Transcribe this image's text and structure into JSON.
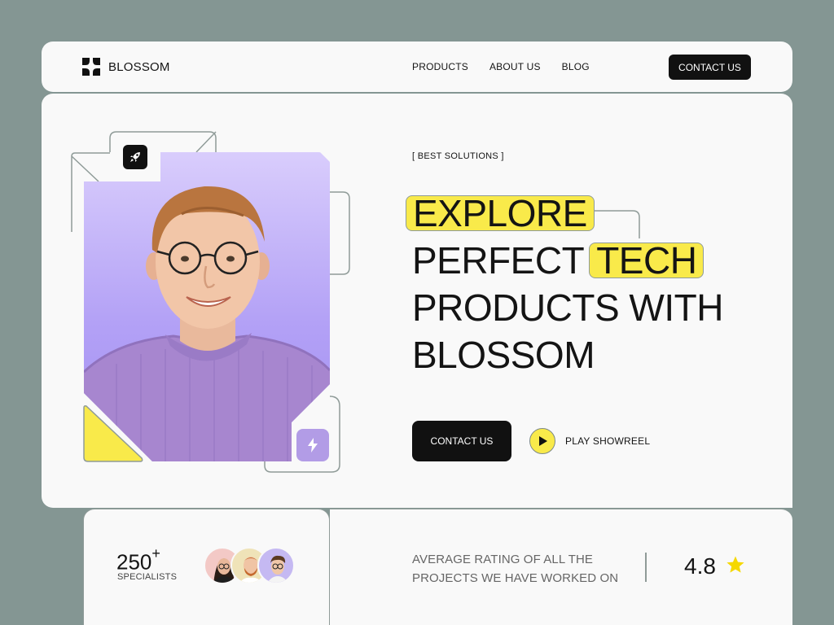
{
  "brand": {
    "name": "BLOSSOM"
  },
  "nav": {
    "items": [
      {
        "label": "PRODUCTS"
      },
      {
        "label": "ABOUT US"
      },
      {
        "label": "BLOG"
      }
    ],
    "cta_label": "CONTACT US"
  },
  "hero": {
    "eyebrow": "[ BEST SOLUTIONS ]",
    "headline": {
      "word1": "EXPLORE",
      "line2_prefix": "PERFECT",
      "line2_highlight": "TECH",
      "line3": "PRODUCTS WITH",
      "line4": "BLOSSOM"
    },
    "cta_label": "CONTACT US",
    "showreel_label": "PLAY SHOWREEL"
  },
  "stats": {
    "specialists_count": "250",
    "specialists_suffix": "+",
    "specialists_label": "SPECIALISTS"
  },
  "rating": {
    "text": "AVERAGE RATING OF ALL THE PROJECTS WE HAVE WORKED ON",
    "value": "4.8"
  },
  "colors": {
    "background": "#849693",
    "card": "#f9f9f9",
    "accent_yellow": "#f9ea4a",
    "accent_purple": "#b3a1f6",
    "dark": "#111111"
  }
}
